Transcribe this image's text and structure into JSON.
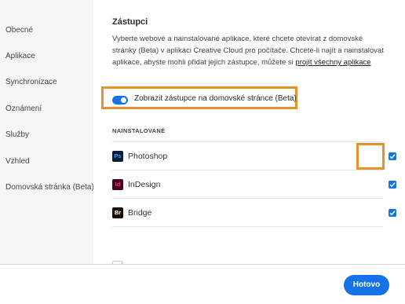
{
  "sidebar": {
    "items": [
      {
        "label": "Obecné"
      },
      {
        "label": "Aplikace"
      },
      {
        "label": "Synchronizace"
      },
      {
        "label": "Oznámení"
      },
      {
        "label": "Služby"
      },
      {
        "label": "Vzhled"
      },
      {
        "label": "Domovská stránka (Beta)"
      }
    ]
  },
  "main": {
    "title": "Zástupci",
    "description": "Vyberte webové a nainstalované aplikace, které chcete otevírat z domovské stránky (Beta) v aplikaci Creative Cloud pro počítače. Chcete-li najít a nainstalovat aplikace, abyste mohli přidat jejich zástupce, můžete si",
    "description_link": "projít všechny aplikace",
    "toggle": {
      "label": "Zobrazit zástupce na domovské stránce (Beta)",
      "on": true
    },
    "section_label": "NAINSTALOVANÉ",
    "apps": [
      {
        "name": "Photoshop",
        "icon_text": "Ps",
        "icon": "photoshop-icon",
        "checked": true
      },
      {
        "name": "InDesign",
        "icon_text": "Id",
        "icon": "indesign-icon",
        "checked": true
      },
      {
        "name": "Bridge",
        "icon_text": "Br",
        "icon": "bridge-icon",
        "checked": true
      }
    ]
  },
  "footer": {
    "done_label": "Hotovo"
  },
  "colors": {
    "accent": "#1473e6",
    "highlight": "#e8902a",
    "photoshop_bg": "#001e36",
    "photoshop_fg": "#31a8ff",
    "indesign_bg": "#49021f",
    "indesign_fg": "#ff3366",
    "bridge_bg": "#1a0a00",
    "bridge_fg": "#ffffff"
  }
}
